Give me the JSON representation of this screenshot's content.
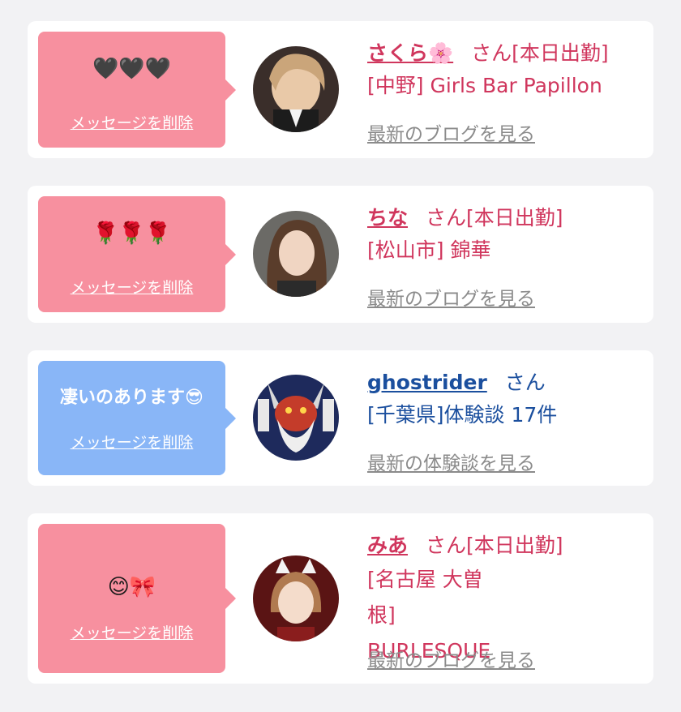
{
  "delete_label": "メッセージを削除",
  "cards": [
    {
      "message": "🖤🖤🖤",
      "name": "さくら🌸",
      "suffix": "さん[本日出勤]",
      "shop": "[中野] Girls Bar Papillon",
      "link": "最新のブログを見る"
    },
    {
      "message": "🌹🌹🌹",
      "name": "ちな",
      "suffix": "さん[本日出勤]",
      "shop": "[松山市] 錦華",
      "link": "最新のブログを見る"
    },
    {
      "message": "凄いのあります😎",
      "name": "ghostrider",
      "suffix": "さん",
      "shop": "[千葉県]体験談 17件",
      "link": "最新の体験談を見る"
    },
    {
      "message": "😊🎀",
      "name": "みあ",
      "suffix": "さん[本日出勤]",
      "shop": "[名古屋 大曽根] BURLESQUE",
      "link": "最新のブログを見る"
    }
  ],
  "colors": {
    "pink_bubble": "#f7909f",
    "blue_bubble": "#89b6f7",
    "pink_text": "#d0365d",
    "blue_text": "#1b4f9e",
    "link_gray": "#8b8b8b"
  }
}
